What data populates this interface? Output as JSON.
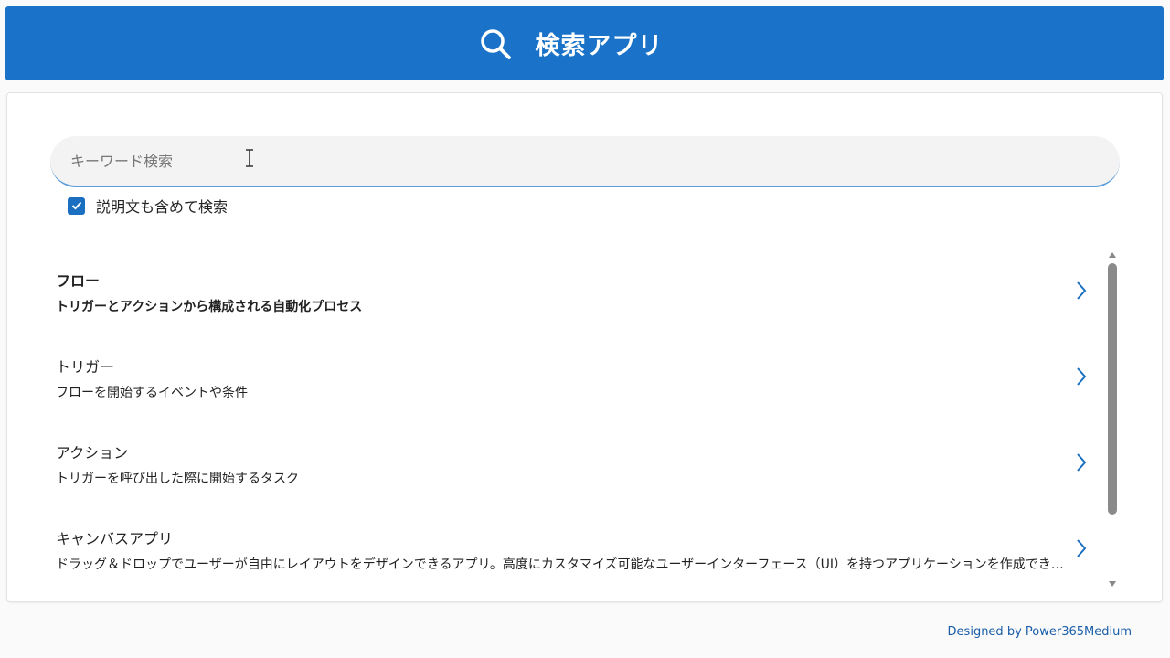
{
  "header": {
    "title": "検索アプリ",
    "icon": "search-icon",
    "bg_color": "#1a73c8"
  },
  "search": {
    "placeholder": "キーワード検索",
    "value": ""
  },
  "include_description": {
    "label": "説明文も含めて検索",
    "checked": true
  },
  "items": [
    {
      "title": "フロー",
      "description": "トリガーとアクションから構成される自動化プロセス",
      "selected": true
    },
    {
      "title": "トリガー",
      "description": "フローを開始するイベントや条件",
      "selected": false
    },
    {
      "title": "アクション",
      "description": "トリガーを呼び出した際に開始するタスク",
      "selected": false
    },
    {
      "title": "キャンバスアプリ",
      "description": "ドラッグ＆ドロップでユーザーが自由にレイアウトをデザインできるアプリ。高度にカスタマイズ可能なユーザーインターフェース（UI）を持つアプリケーションを作成できます。",
      "selected": false
    }
  ],
  "footer": {
    "credit": "Designed by Power365Medium"
  }
}
